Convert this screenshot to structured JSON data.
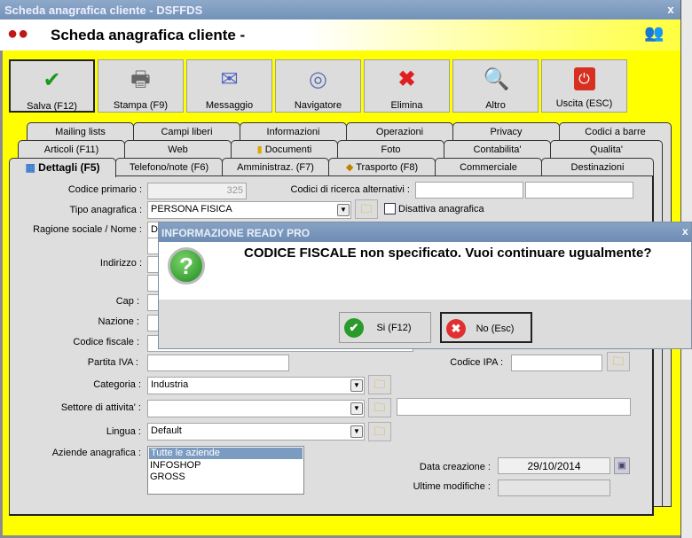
{
  "window": {
    "title": "Scheda anagrafica cliente - DSFFDS",
    "close": "x"
  },
  "header": {
    "title": "Scheda anagrafica cliente -"
  },
  "toolbar": [
    {
      "label": "Salva (F12)",
      "icon": "check-icon"
    },
    {
      "label": "Stampa (F9)",
      "icon": "printer-icon"
    },
    {
      "label": "Messaggio",
      "icon": "mail-icon"
    },
    {
      "label": "Navigatore",
      "icon": "compass-icon"
    },
    {
      "label": "Elimina",
      "icon": "delete-icon"
    },
    {
      "label": "Altro",
      "icon": "search-book-icon"
    },
    {
      "label": "Uscita (ESC)",
      "icon": "power-icon"
    }
  ],
  "tabs": {
    "row1": [
      "Mailing lists",
      "Campi liberi",
      "Informazioni",
      "Operazioni",
      "Privacy",
      "Codici a barre"
    ],
    "row2": [
      "Articoli (F11)",
      "Web",
      "Documenti",
      "Foto",
      "Contabilita'",
      "Qualita'"
    ],
    "row3": [
      "Dettagli (F5)",
      "Telefono/note (F6)",
      "Amministraz. (F7)",
      "Trasporto (F8)",
      "Commerciale",
      "Destinazioni"
    ]
  },
  "form": {
    "codice_primario_label": "Codice primario :",
    "codice_primario": "325",
    "codici_ricerca_label": "Codici di ricerca alternativi :",
    "tipo_label": "Tipo anagrafica :",
    "tipo": "PERSONA FISICA",
    "disattiva_label": "Disattiva anagrafica",
    "ragione_label": "Ragione sociale / Nome :",
    "ragione": "DS",
    "indirizzo_label": "Indirizzo :",
    "cap_label": "Cap :",
    "nazione_label": "Nazione :",
    "cf_label": "Codice fiscale :",
    "piva_label": "Partita IVA :",
    "ipa_label": "Codice IPA :",
    "categoria_label": "Categoria :",
    "categoria": "Industria",
    "settore_label": "Settore di attivita' :",
    "lingua_label": "Lingua :",
    "lingua": "Default",
    "aziende_label": "Aziende anagrafica :",
    "aziende": [
      "Tutte le aziende",
      "INFOSHOP",
      "GROSS"
    ],
    "data_label": "Data creazione :",
    "data": "29/10/2014",
    "modifiche_label": "Ultime modifiche :"
  },
  "dialog": {
    "title": "INFORMAZIONE READY PRO",
    "message": "CODICE FISCALE non specificato. Vuoi continuare ugualmente?",
    "yes": "Si (F12)",
    "no": "No (Esc)",
    "close": "x"
  }
}
